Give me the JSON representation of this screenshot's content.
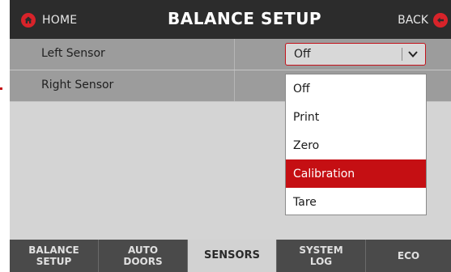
{
  "header": {
    "home_label": "HOME",
    "title": "BALANCE SETUP",
    "back_label": "BACK"
  },
  "rows": [
    {
      "label": "Left Sensor",
      "value": "Off"
    },
    {
      "label": "Right Sensor"
    }
  ],
  "dropdown": {
    "options": [
      "Off",
      "Print",
      "Zero",
      "Calibration",
      "Tare"
    ],
    "highlighted": "Calibration"
  },
  "nav": {
    "tabs": [
      {
        "label": "BALANCE\nSETUP"
      },
      {
        "label": "AUTO\nDOORS"
      },
      {
        "label": "SENSORS",
        "active": true
      },
      {
        "label": "SYSTEM\nLOG"
      },
      {
        "label": "ECO"
      }
    ]
  },
  "colors": {
    "accent": "#d8232a",
    "highlight": "#c50f13",
    "header_bg": "#2c2c2c",
    "row_bg": "#9c9c9c",
    "nav_bg": "#4a4a4a"
  },
  "icons": {
    "home": "home-icon",
    "back": "back-arrow-icon",
    "select": "chevron-down-icon"
  }
}
